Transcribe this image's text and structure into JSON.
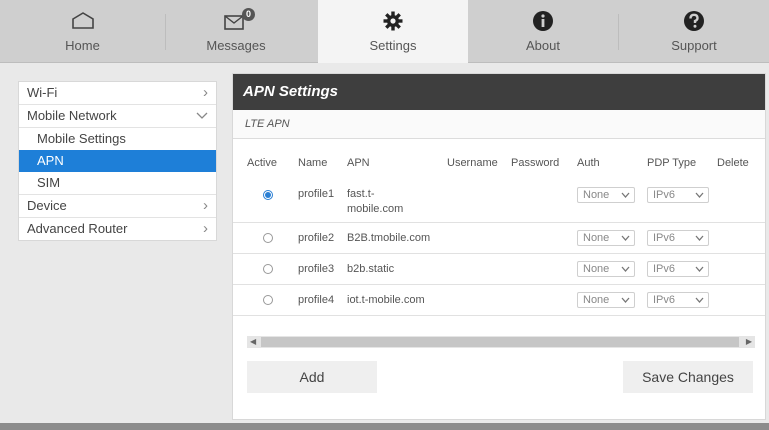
{
  "nav": {
    "tabs": [
      {
        "label": "Home",
        "icon": "home-icon"
      },
      {
        "label": "Messages",
        "icon": "messages-icon",
        "badge": "0"
      },
      {
        "label": "Settings",
        "icon": "settings-gear-icon",
        "active": true
      },
      {
        "label": "About",
        "icon": "info-icon"
      },
      {
        "label": "Support",
        "icon": "help-icon"
      }
    ]
  },
  "sidebar": {
    "items": [
      {
        "label": "Wi-Fi",
        "arrow": "›"
      },
      {
        "label": "Mobile Network",
        "expanded": true
      },
      {
        "label": "Device",
        "arrow": "›"
      },
      {
        "label": "Advanced Router",
        "arrow": "›"
      }
    ],
    "sub_items": [
      {
        "label": "Mobile Settings"
      },
      {
        "label": "APN",
        "active": true
      },
      {
        "label": "SIM"
      }
    ]
  },
  "panel": {
    "title": "APN Settings",
    "subtitle": "LTE APN",
    "columns": [
      "Active",
      "Name",
      "APN",
      "Username",
      "Password",
      "Auth",
      "PDP Type",
      "Delete"
    ],
    "rows": [
      {
        "active": true,
        "name": "profile1",
        "apn_line1": "fast.t-",
        "apn_line2": "mobile.com",
        "auth": "None",
        "pdp": "IPv6"
      },
      {
        "active": false,
        "name": "profile2",
        "apn": "B2B.tmobile.com",
        "auth": "None",
        "pdp": "IPv6"
      },
      {
        "active": false,
        "name": "profile3",
        "apn": "b2b.static",
        "auth": "None",
        "pdp": "IPv6"
      },
      {
        "active": false,
        "name": "profile4",
        "apn": "iot.t-mobile.com",
        "auth": "None",
        "pdp": "IPv6"
      }
    ],
    "add_label": "Add",
    "save_label": "Save Changes"
  },
  "colors": {
    "accent": "#1e7fd8",
    "header_dark": "#3e3e3e",
    "nav_bg": "#cfcfcf"
  }
}
